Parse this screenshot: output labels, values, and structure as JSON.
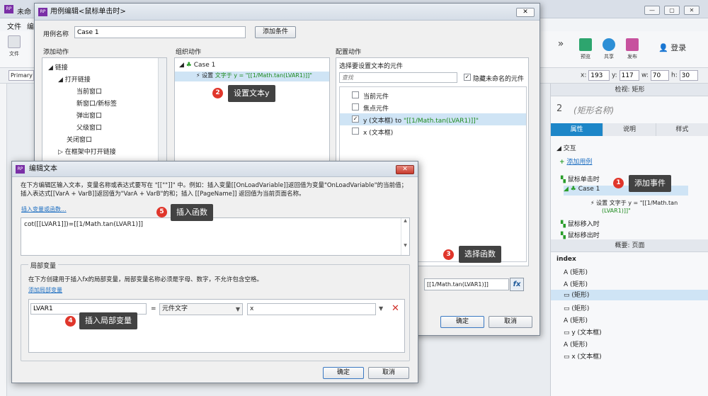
{
  "app": {
    "title_fragment": "未命",
    "menu": [
      "文件",
      "编"
    ],
    "toolbar_file": "文件",
    "primary_label": "Primary",
    "toolbar_right": {
      "preview": "预览",
      "share": "共享",
      "publish": "发布",
      "login": "登录"
    },
    "coords": {
      "x_label": "x:",
      "x": "193",
      "y_label": "y:",
      "y": "117",
      "w_label": "w:",
      "w": "70",
      "h_label": "h:",
      "h": "30"
    }
  },
  "right_panel": {
    "inspector_title": "检视: 矩形",
    "shape_number": "2",
    "shape_name": "(矩形名称)",
    "tabs": [
      "属性",
      "说明",
      "样式"
    ],
    "interaction_label": "交互",
    "add_case": "添加用例",
    "events": {
      "click": "鼠标单击时",
      "case": "Case 1",
      "action": "设置 文字于 y = \"[[1/Math.tan",
      "action2": "(LVAR1)]]\"",
      "mouse_enter": "鼠标移入时",
      "mouse_leave": "鼠标移出时"
    },
    "outline_title": "概要: 页面",
    "outline_root": "index",
    "outline_items": [
      "(矩形)",
      "(矩形)",
      "(矩形)",
      "(矩形)",
      "(矩形)",
      "y (文本框)",
      "(矩形)",
      "x (文本框)"
    ]
  },
  "case_editor": {
    "title": "用例编辑<鼠标单击时>",
    "case_name_label": "用例名称",
    "case_name_value": "Case 1",
    "add_condition": "添加条件",
    "add_action_title": "添加动作",
    "organize_title": "组织动作",
    "configure_title": "配置动作",
    "add_action_tree": [
      "链接",
      "打开链接",
      "当前窗口",
      "新窗口/新标签",
      "弹出窗口",
      "父级窗口",
      "关闭窗口",
      "在框架中打开链接"
    ],
    "organize_case": "Case 1",
    "organize_action_prefix": "设置",
    "organize_action": "文字于 y = \"[[1/Math.tan(LVAR1)]]\"",
    "select_widget_label": "选择要设置文本的元件",
    "search_placeholder": "查找",
    "hide_unnamed": "隐藏未命名的元件",
    "widgets": [
      {
        "label": "当前元件",
        "checked": false
      },
      {
        "label": "焦点元件",
        "checked": false
      },
      {
        "label": "y (文本框)",
        "suffix": " to ",
        "value": "\"[[1/Math.tan(LVAR1)]]\"",
        "checked": true
      },
      {
        "label": "x (文本框)",
        "checked": false
      }
    ],
    "value_field": "[[1/Math.tan(LVAR1)]]",
    "fx": "fx",
    "ok": "确定",
    "cancel": "取消"
  },
  "edit_text": {
    "title": "编辑文本",
    "description": "在下方编辑区输入文本，变量名称或表达式要写在 \"[[\"\"]]\" 中。例如：插入变量[[OnLoadVariable]]返回值为变量\"OnLoadVariable\"的当前值；插入表达式[[VarA + VarB]]返回值为\"VarA + VarB\"的和；插入 [[PageName]] 返回值为当前页面名称。",
    "insert_link": "插入变量或函数...",
    "editor_text": "cot([[LVAR1]])=[[1/Math.tan(LVAR1)]]",
    "local_title": "局部变量",
    "local_desc": "在下方创建用于插入fx的局部变量，局部变量名称必须是字母、数字，不允许包含空格。",
    "add_local": "添加局部变量",
    "var_name": "LVAR1",
    "equals": "=",
    "var_type": "元件文字",
    "var_target": "x",
    "ok": "确定",
    "cancel": "取消"
  },
  "callouts": [
    {
      "num": "1",
      "text": "添加事件"
    },
    {
      "num": "2",
      "text": "设置文本y"
    },
    {
      "num": "3",
      "text": "选择函数"
    },
    {
      "num": "4",
      "text": "插入局部变量"
    },
    {
      "num": "5",
      "text": "插入函数"
    }
  ],
  "colors": {
    "accent": "#1d86c8",
    "callout_bg": "#424242",
    "badge": "#e0362b",
    "green_text": "#1d8a1d",
    "link": "#1e6fc2"
  }
}
